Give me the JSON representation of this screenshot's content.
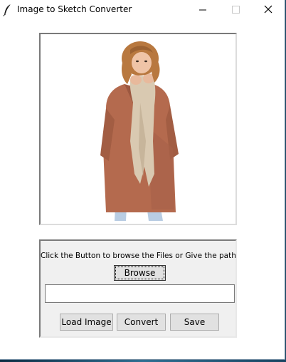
{
  "window": {
    "title": "Image to Sketch Converter",
    "app_icon": "feather-icon",
    "controls": {
      "minimize_icon": "minimize-icon",
      "maximize_icon": "maximize-icon",
      "close_icon": "close-icon"
    }
  },
  "preview": {
    "content": "woman-in-coat-photo"
  },
  "panel": {
    "instruction": "Click the Button to browse the Files or Give the path",
    "browse_label": "Browse",
    "path_value": "",
    "load_label": "Load Image",
    "convert_label": "Convert",
    "save_label": "Save"
  }
}
